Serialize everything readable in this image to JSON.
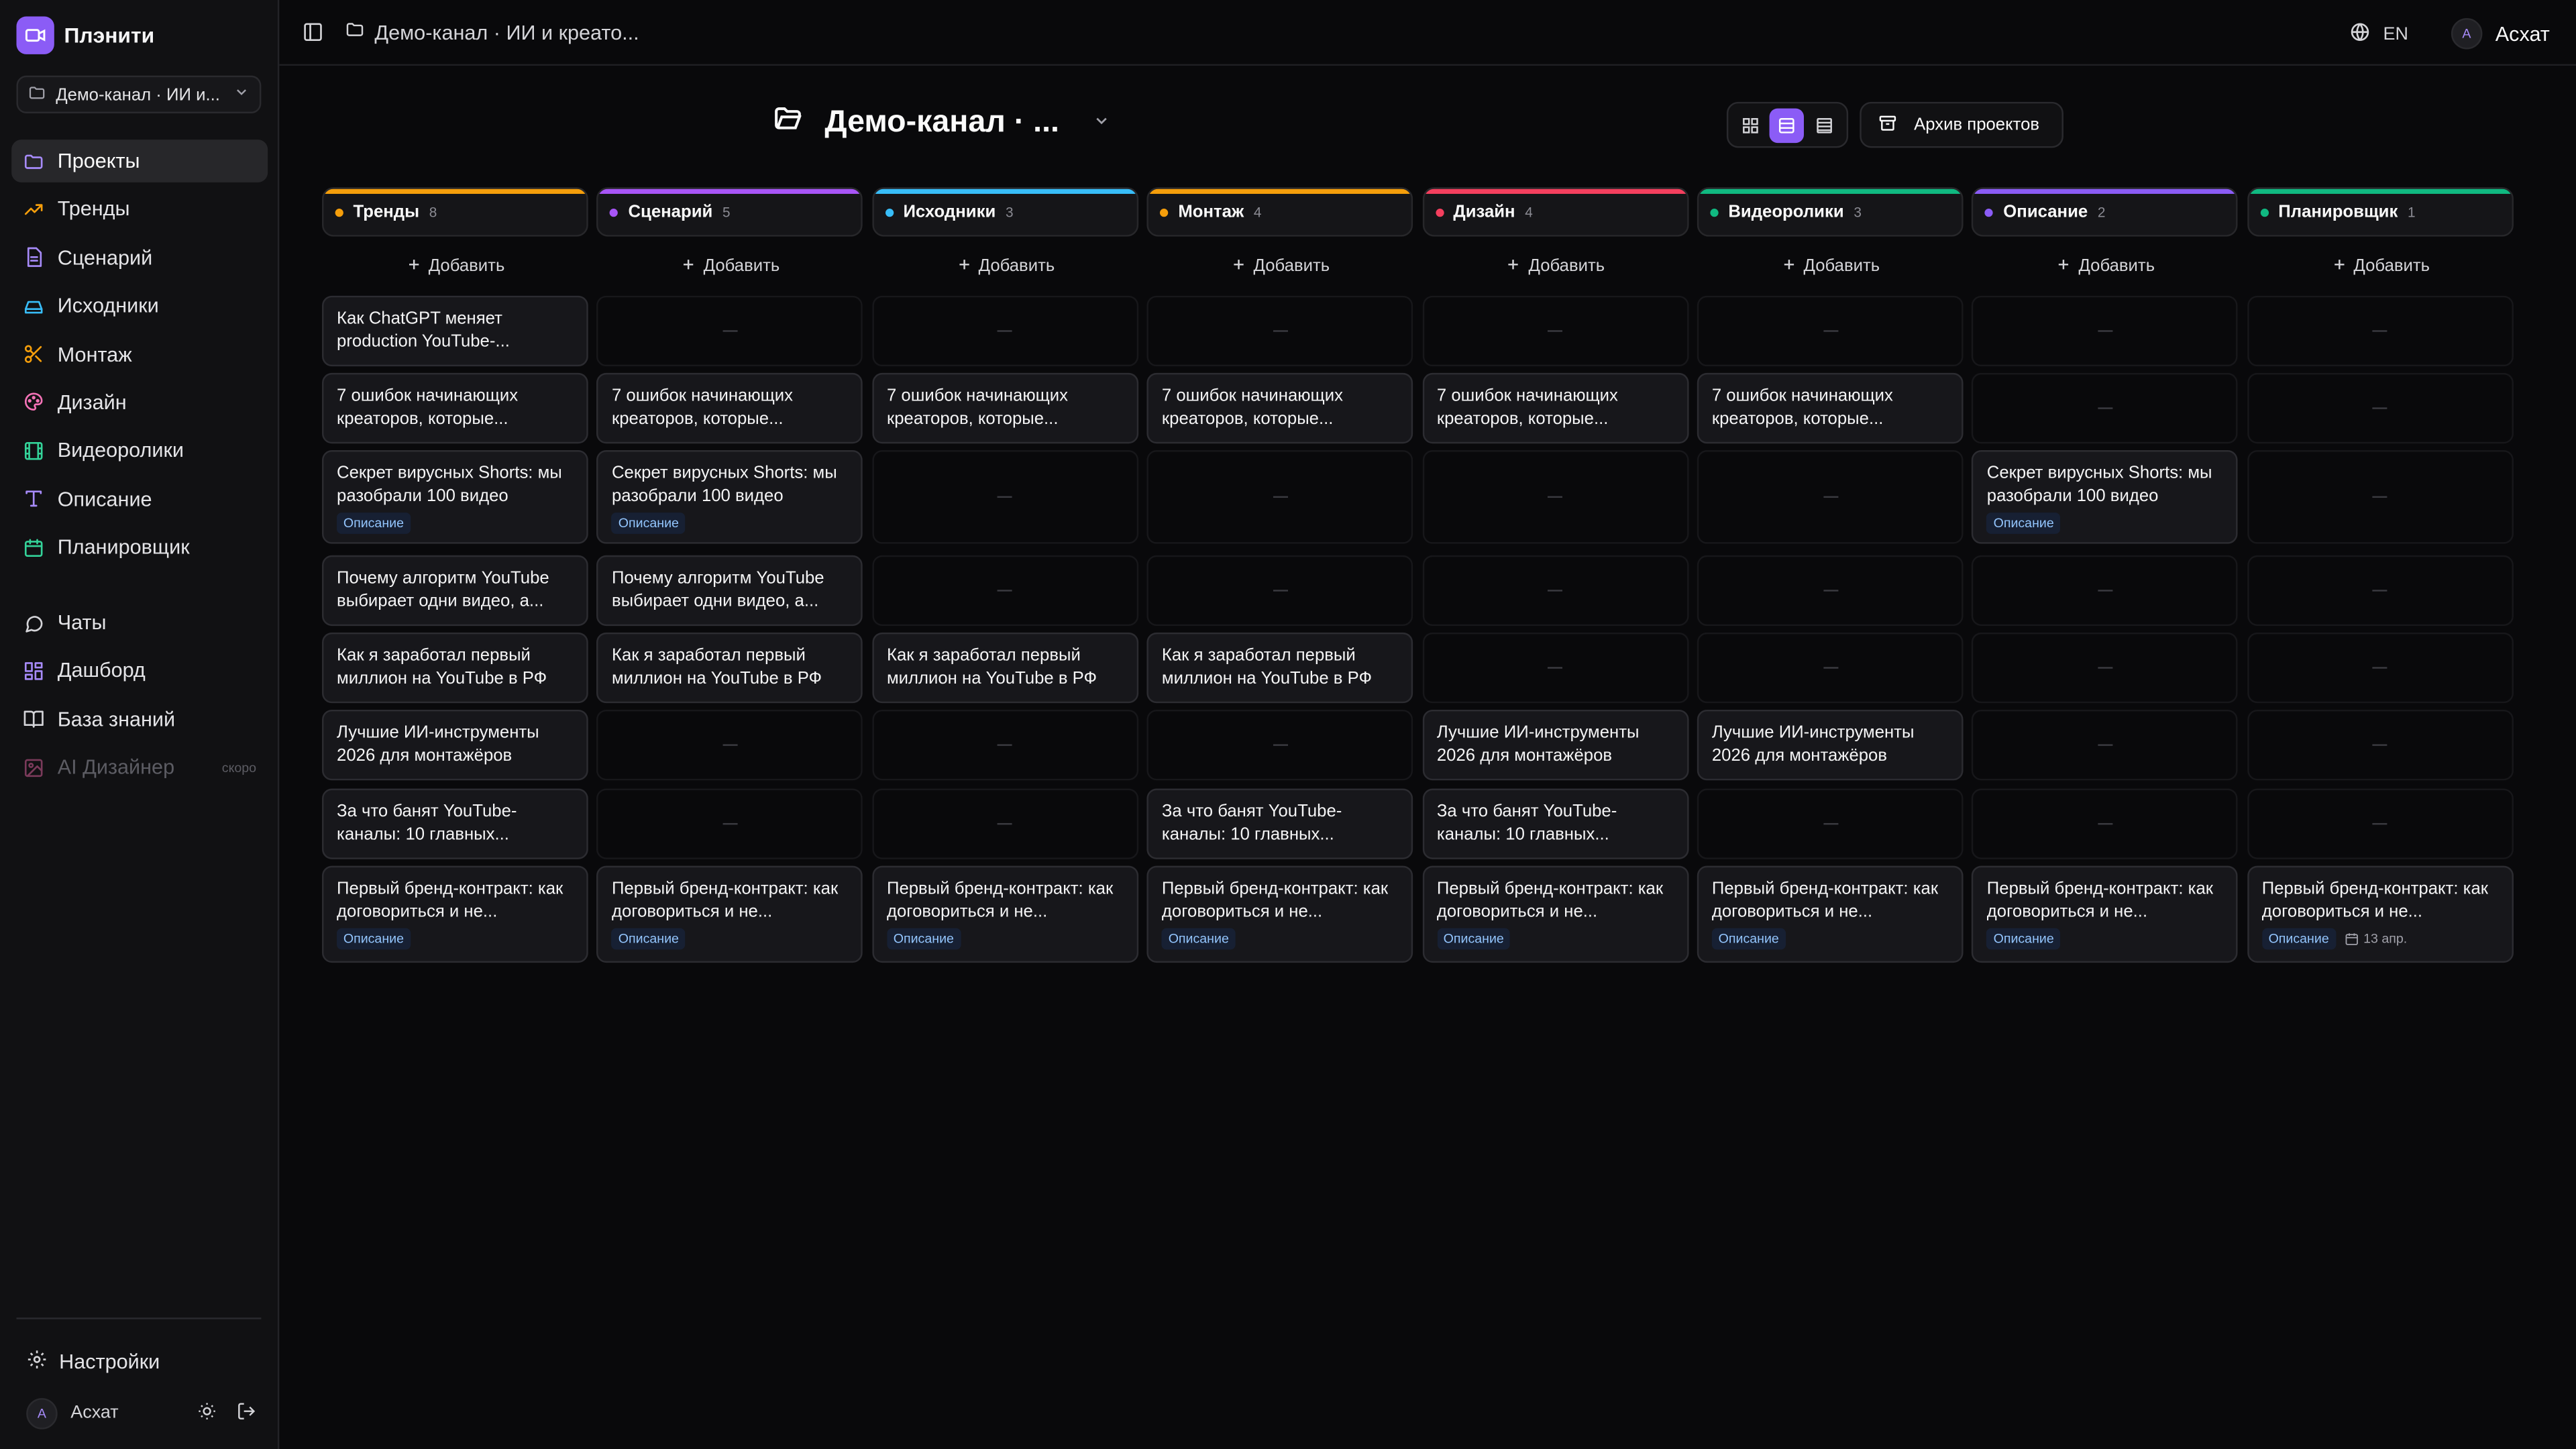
{
  "app": {
    "name": "Плэнити"
  },
  "sidebar": {
    "channel": "Демо-канал · ИИ и...",
    "nav_main": [
      {
        "label": "Проекты",
        "icon": "folder-icon",
        "color": "#a78bfa",
        "active": true
      },
      {
        "label": "Тренды",
        "icon": "trending-icon",
        "color": "#f59e0b"
      },
      {
        "label": "Сценарий",
        "icon": "document-icon",
        "color": "#a78bfa"
      },
      {
        "label": "Исходники",
        "icon": "drive-icon",
        "color": "#38bdf8"
      },
      {
        "label": "Монтаж",
        "icon": "scissors-icon",
        "color": "#f59e0b"
      },
      {
        "label": "Дизайн",
        "icon": "palette-icon",
        "color": "#f472b6"
      },
      {
        "label": "Видеоролики",
        "icon": "film-icon",
        "color": "#34d399"
      },
      {
        "label": "Описание",
        "icon": "text-icon",
        "color": "#a78bfa"
      },
      {
        "label": "Планировщик",
        "icon": "calendar-icon",
        "color": "#34d399"
      }
    ],
    "nav_secondary": [
      {
        "label": "Чаты",
        "icon": "chat-icon",
        "color": "#d4d4d8"
      },
      {
        "label": "Дашборд",
        "icon": "dashboard-icon",
        "color": "#a78bfa"
      },
      {
        "label": "База знаний",
        "icon": "book-icon",
        "color": "#d4d4d8"
      },
      {
        "label": "AI Дизайнер",
        "icon": "image-icon",
        "color": "#f472b6",
        "disabled": true,
        "badge": "скоро"
      }
    ],
    "settings": "Настройки",
    "user": {
      "initial": "A",
      "name": "Асхат"
    }
  },
  "topbar": {
    "breadcrumb": "Демо-канал · ИИ и креато...",
    "lang": "EN",
    "user_initial": "A",
    "user_name": "Асхат"
  },
  "header": {
    "title": "Демо-канал · ...",
    "archive": "Архив проектов",
    "view_mode": "list"
  },
  "add_label": "Добавить",
  "columns": [
    {
      "name": "Тренды",
      "count": "8",
      "color": "#f59e0b"
    },
    {
      "name": "Сценарий",
      "count": "5",
      "color": "#a855f7"
    },
    {
      "name": "Исходники",
      "count": "3",
      "color": "#38bdf8"
    },
    {
      "name": "Монтаж",
      "count": "4",
      "color": "#f59e0b"
    },
    {
      "name": "Дизайн",
      "count": "4",
      "color": "#f43f5e"
    },
    {
      "name": "Видеоролики",
      "count": "3",
      "color": "#10b981"
    },
    {
      "name": "Описание",
      "count": "2",
      "color": "#8b5cf6"
    },
    {
      "name": "Планировщик",
      "count": "1",
      "color": "#10b981"
    }
  ],
  "rows": [
    {
      "title": "Как ChatGPT меняет production YouTube-...",
      "cells": [
        1,
        0,
        0,
        0,
        0,
        0,
        0,
        0
      ],
      "tag": "",
      "date": ""
    },
    {
      "title": "7 ошибок начинающих креаторов, которые...",
      "cells": [
        1,
        1,
        1,
        1,
        1,
        1,
        0,
        0
      ],
      "tag": "",
      "date": ""
    },
    {
      "title": "Секрет вирусных Shorts: мы разобрали 100 видео",
      "cells": [
        1,
        1,
        0,
        0,
        0,
        0,
        1,
        0
      ],
      "tag": "Описание",
      "date": ""
    },
    {
      "title": "Почему алгоритм YouTube выбирает одни видео, а...",
      "cells": [
        1,
        1,
        0,
        0,
        0,
        0,
        0,
        0
      ],
      "tag": "",
      "date": ""
    },
    {
      "title": "Как я заработал первый миллион на YouTube в РФ",
      "cells": [
        1,
        1,
        1,
        1,
        0,
        0,
        0,
        0
      ],
      "tag": "",
      "date": ""
    },
    {
      "title": "Лучшие ИИ-инструменты 2026 для монтажёров",
      "cells": [
        1,
        0,
        0,
        0,
        1,
        1,
        0,
        0
      ],
      "tag": "",
      "date": ""
    },
    {
      "title": "За что банят YouTube-каналы: 10 главных...",
      "cells": [
        1,
        0,
        0,
        1,
        1,
        0,
        0,
        0
      ],
      "tag": "",
      "date": ""
    },
    {
      "title": "Первый бренд-контракт: как договориться и не...",
      "cells": [
        1,
        1,
        1,
        1,
        1,
        1,
        1,
        1
      ],
      "tag": "Описание",
      "date": "13 апр."
    }
  ]
}
